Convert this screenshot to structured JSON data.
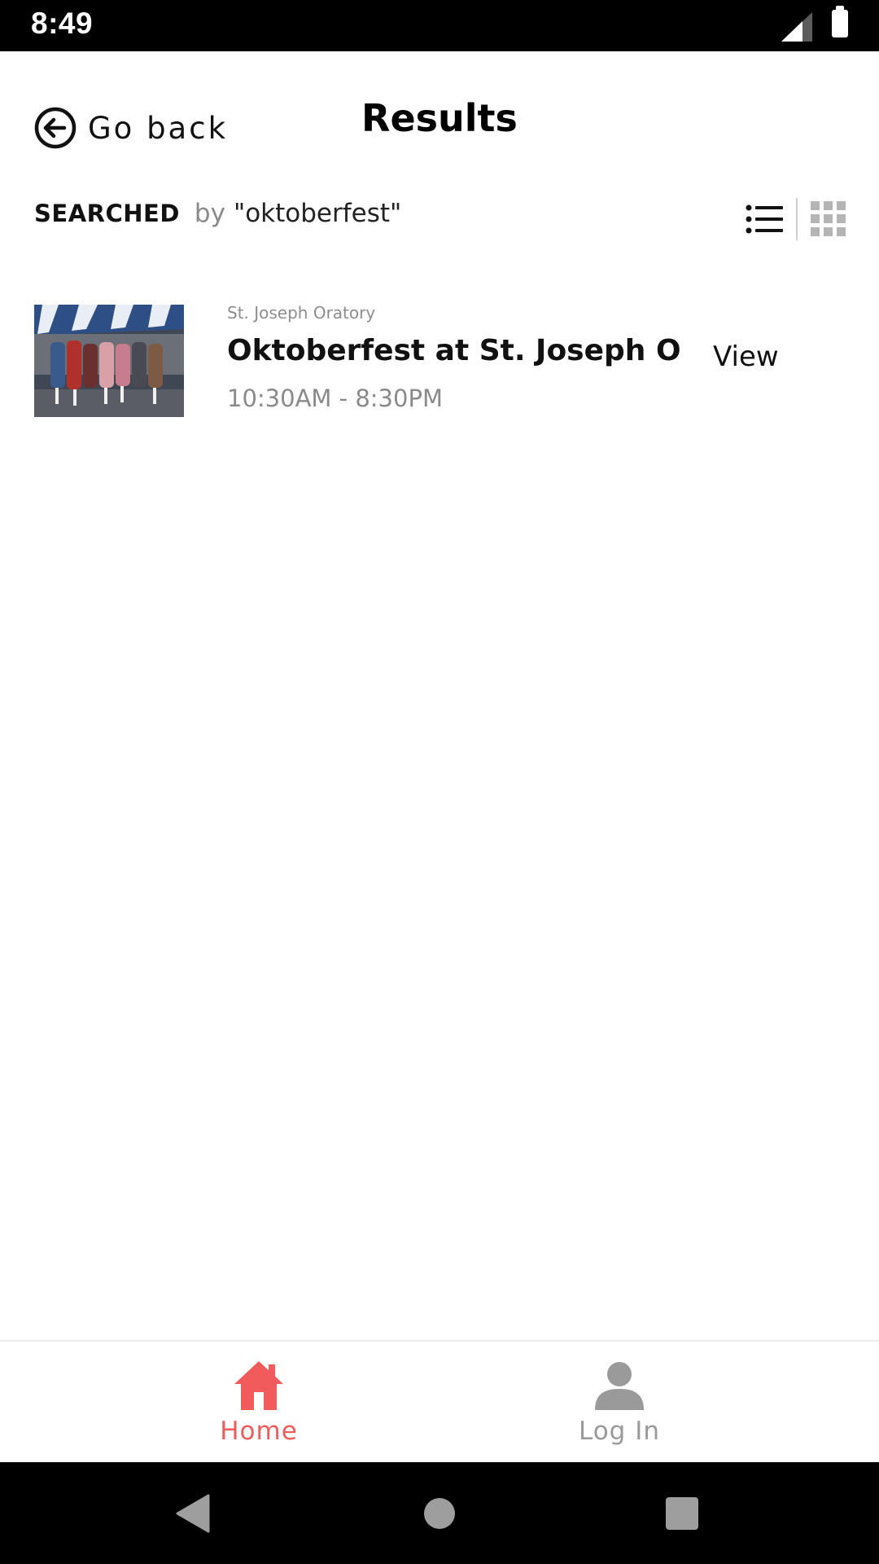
{
  "status_bar": {
    "time": "8:49",
    "icons": [
      "signal-icon",
      "battery-icon"
    ]
  },
  "header": {
    "back_label": "Go back",
    "title": "Results"
  },
  "search_summary": {
    "label": "SEARCHED",
    "by": "by",
    "query": "\"oktoberfest\""
  },
  "view_toggle": {
    "icons": [
      "list-view-icon",
      "grid-view-icon"
    ]
  },
  "results": [
    {
      "venue": "St. Joseph Oratory",
      "title": "Oktoberfest at St. Joseph Or...",
      "time": "10:30AM - 8:30PM",
      "action": "View"
    }
  ],
  "tab_bar": {
    "tabs": [
      {
        "label": "Home",
        "icon": "home-icon",
        "active": true
      },
      {
        "label": "Log In",
        "icon": "user-icon",
        "active": false
      }
    ]
  },
  "colors": {
    "accent": "#f25b5b",
    "inactive": "#9a9a9a",
    "status_bar_bg": "#000000",
    "nav_bar_bg": "#000000",
    "nav_icon": "#9e9e9e"
  },
  "nav_bar": {
    "icons": [
      "back-triangle-icon",
      "home-circle-icon",
      "recents-square-icon"
    ]
  }
}
